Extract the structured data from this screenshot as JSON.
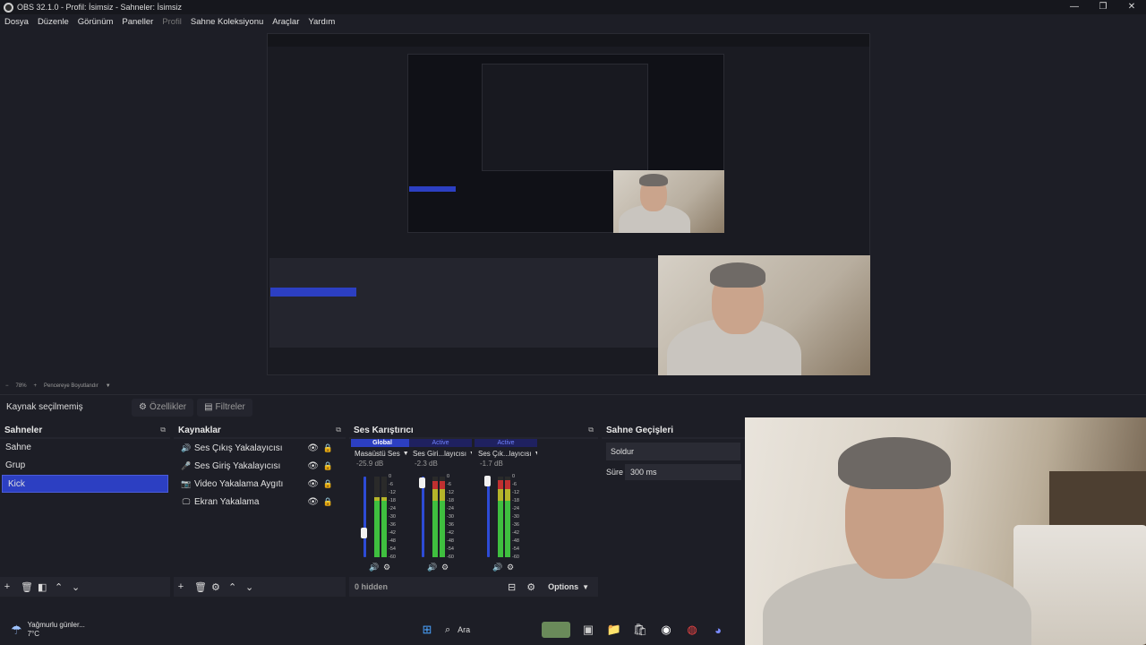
{
  "window": {
    "title": "OBS 32.1.0 - Profil: İsimsiz - Sahneler: İsimsiz",
    "controls": {
      "minimize": "—",
      "maximize": "❐",
      "close": "✕"
    }
  },
  "menu": {
    "items": [
      "Dosya",
      "Düzenle",
      "Görünüm",
      "Paneller",
      "Profil",
      "Sahne Koleksiyonu",
      "Araçlar",
      "Yardım"
    ]
  },
  "preview_status": {
    "zoom": "78%",
    "fit_label": "Pencereye Boyutlandır"
  },
  "context_bar": {
    "no_source": "Kaynak seçilmemiş",
    "properties_label": "Özellikler",
    "filters_label": "Filtreler"
  },
  "scenes": {
    "title": "Sahneler",
    "items": [
      "Sahne",
      "Grup",
      "Kick"
    ],
    "selected": "Kick"
  },
  "sources": {
    "title": "Kaynaklar",
    "items": [
      {
        "label": "Ses Çıkış Yakalayıcısı",
        "icon": "speaker-icon"
      },
      {
        "label": "Ses Giriş Yakalayıcısı",
        "icon": "microphone-icon"
      },
      {
        "label": "Video Yakalama Aygıtı",
        "icon": "camera-icon"
      },
      {
        "label": "Ekran Yakalama",
        "icon": "monitor-icon"
      }
    ]
  },
  "mixer": {
    "title": "Ses Karıştırıcı",
    "channels": [
      {
        "tag": "Global",
        "name": "Masaüstü Ses",
        "db": "-25.9 dB",
        "volume_percent": 30,
        "level_percent": 75
      },
      {
        "tag": "Active",
        "name": "Ses Giri...layıcısı",
        "db": "-2.3 dB",
        "volume_percent": 92,
        "level_percent": 95
      },
      {
        "tag": "Active",
        "name": "Ses Çık...layıcısı",
        "db": "-1.7 dB",
        "volume_percent": 94,
        "level_percent": 96
      }
    ],
    "scale": [
      "0",
      "-6",
      "-12",
      "-18",
      "-24",
      "-30",
      "-36",
      "-42",
      "-48",
      "-54",
      "-60"
    ],
    "hidden_label": "0 hidden",
    "options_label": "Options"
  },
  "transitions": {
    "title": "Sahne Geçişleri",
    "selected": "Soldur",
    "duration_label": "Süre",
    "duration_value": "300 ms"
  },
  "taskbar": {
    "weather_text": "Yağmurlu günler...",
    "weather_temp": "7°C",
    "search_label": "Ara"
  },
  "colors": {
    "accent": "#2c3fc2",
    "background": "#1d1e26",
    "panel": "#24252e",
    "meter_green": "#3fbf3f",
    "meter_yellow": "#b5b52a",
    "meter_red": "#c03030"
  }
}
